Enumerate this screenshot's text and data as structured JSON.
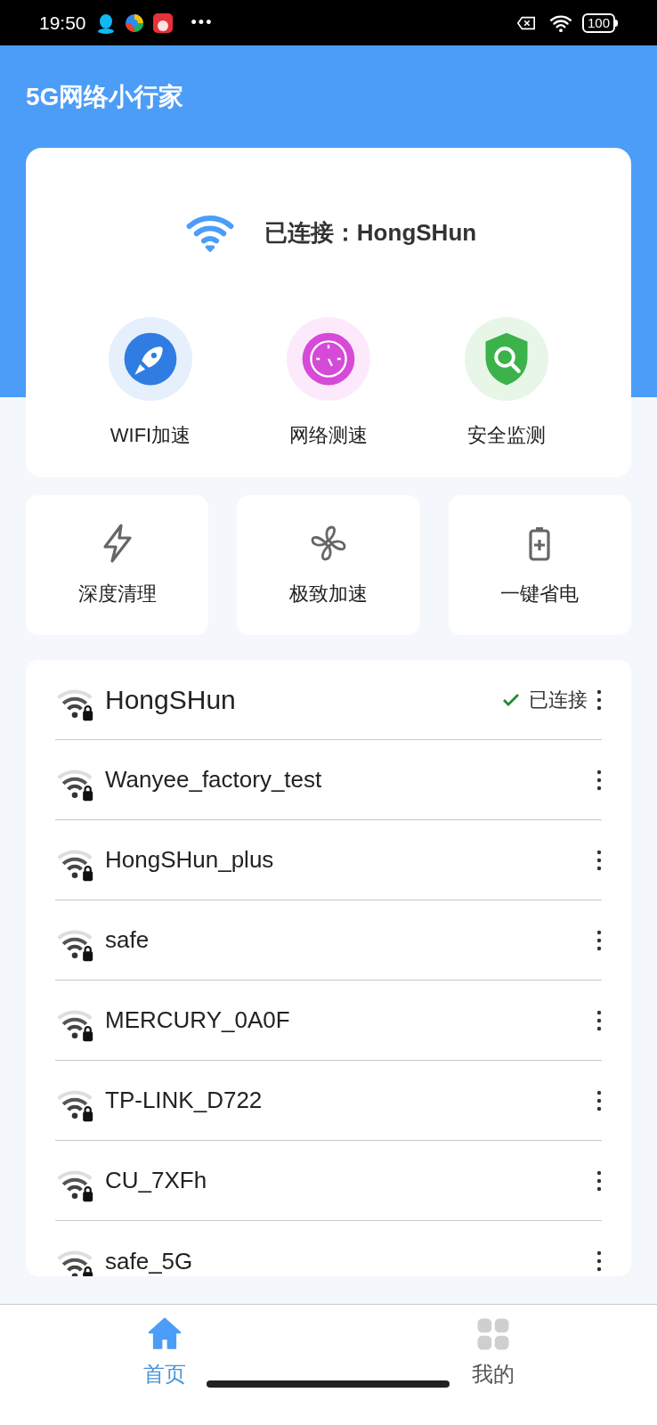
{
  "status_bar": {
    "time": "19:50",
    "more": "•••",
    "battery": "100"
  },
  "app_bar": {
    "title": "5G网络小行家"
  },
  "connection": {
    "label": "已连接：HongSHun"
  },
  "main_actions": [
    {
      "kind": "rocket",
      "label": "WIFI加速"
    },
    {
      "kind": "gauge",
      "label": "网络测速"
    },
    {
      "kind": "shield",
      "label": "安全监测"
    }
  ],
  "tools": [
    {
      "kind": "bolt",
      "label": "深度清理"
    },
    {
      "kind": "fan",
      "label": "极致加速"
    },
    {
      "kind": "battery",
      "label": "一键省电"
    }
  ],
  "networks": [
    {
      "name": "HongSHun",
      "connected": true,
      "status": "已连接"
    },
    {
      "name": "Wanyee_factory_test",
      "connected": false
    },
    {
      "name": "HongSHun_plus",
      "connected": false
    },
    {
      "name": "safe",
      "connected": false
    },
    {
      "name": "MERCURY_0A0F",
      "connected": false
    },
    {
      "name": "TP-LINK_D722",
      "connected": false
    },
    {
      "name": "CU_7XFh",
      "connected": false
    },
    {
      "name": "safe_5G",
      "connected": false
    }
  ],
  "bottom_nav": [
    {
      "kind": "home",
      "label": "首页",
      "selected": true
    },
    {
      "kind": "grid",
      "label": "我的",
      "selected": false
    }
  ]
}
